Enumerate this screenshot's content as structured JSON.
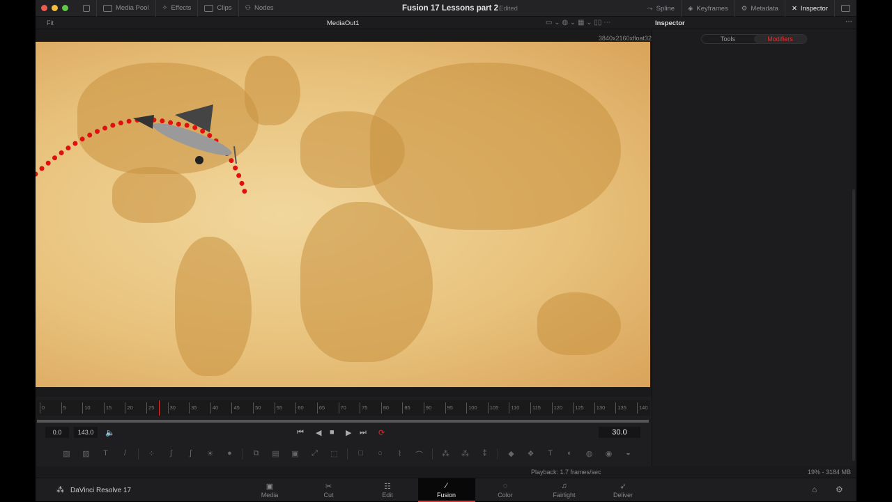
{
  "topbar": {
    "media_pool": "Media Pool",
    "effects": "Effects",
    "clips": "Clips",
    "nodes": "Nodes",
    "title": "Fusion 17 Lessons part 2",
    "status": "Edited",
    "spline": "Spline",
    "keyframes": "Keyframes",
    "metadata": "Metadata",
    "inspector": "Inspector"
  },
  "viewer": {
    "zoom": "Fit",
    "node": "MediaOut1",
    "resolution": "3840x2160xfloat32"
  },
  "inspector": {
    "title": "Inspector",
    "tabs": [
      "Tools",
      "Modifiers"
    ]
  },
  "timeline": {
    "ticks": [
      "0",
      "5",
      "10",
      "15",
      "20",
      "25",
      "30",
      "35",
      "40",
      "45",
      "50",
      "55",
      "60",
      "65",
      "70",
      "75",
      "80",
      "85",
      "90",
      "95",
      "100",
      "105",
      "110",
      "115",
      "120",
      "125",
      "130",
      "135",
      "140"
    ],
    "playhead": 28,
    "render_start": "0.0",
    "render_end": "143.0",
    "current_frame": "30.0"
  },
  "status": {
    "playback": "Playback: 1.7 frames/sec",
    "memory": "19% - 3184 MB"
  },
  "app": {
    "name": "DaVinci Resolve 17"
  },
  "pages": [
    {
      "label": "Media",
      "icon": "▣"
    },
    {
      "label": "Cut",
      "icon": "✂"
    },
    {
      "label": "Edit",
      "icon": "☷"
    },
    {
      "label": "Fusion",
      "icon": "⁄"
    },
    {
      "label": "Color",
      "icon": "◌"
    },
    {
      "label": "Fairlight",
      "icon": "♫"
    },
    {
      "label": "Deliver",
      "icon": "➶"
    }
  ],
  "active_page": "Fusion",
  "colors": {
    "accent": "#e0312f",
    "title": "#e6e6e6"
  }
}
